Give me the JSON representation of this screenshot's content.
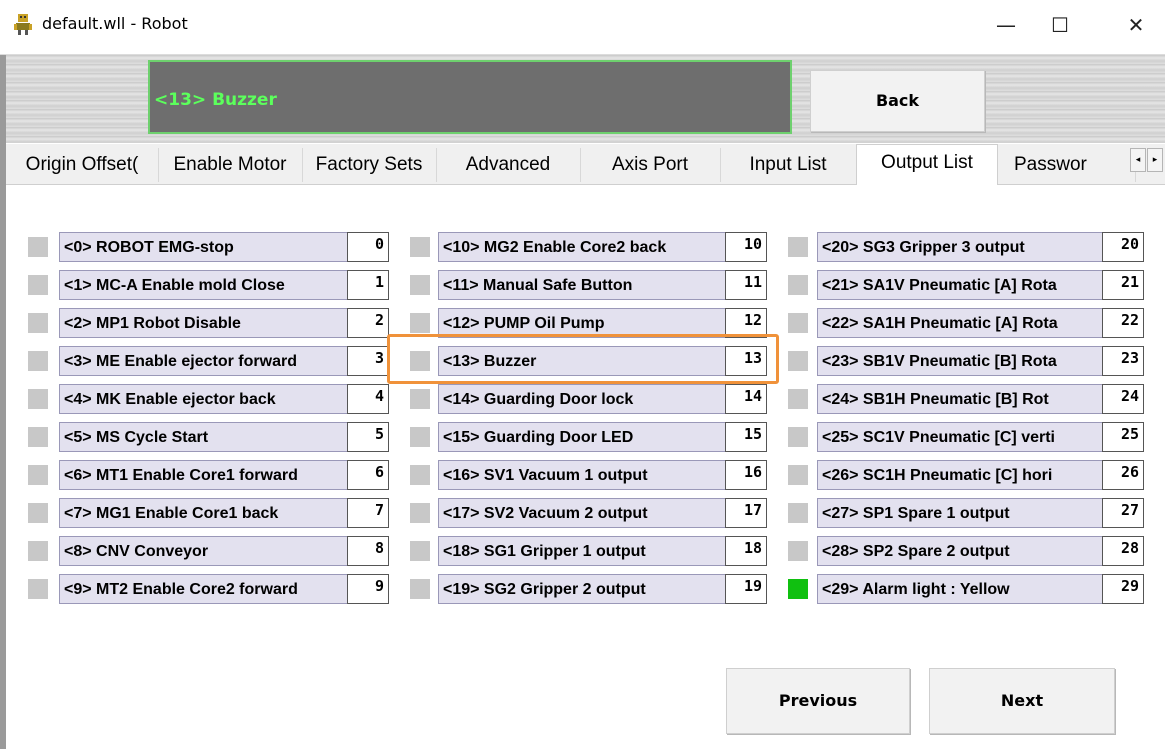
{
  "window": {
    "title": "default.wll - Robot",
    "controls": {
      "minimize": "—",
      "maximize": "☐",
      "close": "✕"
    }
  },
  "display": {
    "text": "<13> Buzzer"
  },
  "buttons": {
    "back": "Back",
    "previous": "Previous",
    "next": "Next"
  },
  "tabs": [
    {
      "label": "Origin Offset(",
      "active": false
    },
    {
      "label": "Enable Motor",
      "active": false
    },
    {
      "label": "Factory Sets",
      "active": false
    },
    {
      "label": "Advanced",
      "active": false
    },
    {
      "label": "Axis Port",
      "active": false
    },
    {
      "label": "Input List",
      "active": false
    },
    {
      "label": "Output List",
      "active": true
    },
    {
      "label": "Passwor",
      "active": false
    }
  ],
  "tab_scroll": {
    "left": "◂",
    "right": "▸"
  },
  "outputs": [
    {
      "label": "<0> ROBOT EMG-stop",
      "number": "0",
      "on": false
    },
    {
      "label": "<1> MC-A Enable mold Close",
      "number": "1",
      "on": false
    },
    {
      "label": "<2> MP1 Robot Disable",
      "number": "2",
      "on": false
    },
    {
      "label": "<3> ME Enable ejector forward",
      "number": "3",
      "on": false
    },
    {
      "label": "<4> MK Enable ejector back",
      "number": "4",
      "on": false
    },
    {
      "label": "<5> MS Cycle Start",
      "number": "5",
      "on": false
    },
    {
      "label": "<6> MT1 Enable Core1 forward",
      "number": "6",
      "on": false
    },
    {
      "label": "<7> MG1 Enable Core1 back",
      "number": "7",
      "on": false
    },
    {
      "label": "<8> CNV Conveyor",
      "number": "8",
      "on": false
    },
    {
      "label": "<9> MT2 Enable Core2 forward",
      "number": "9",
      "on": false
    },
    {
      "label": "<10> MG2 Enable Core2 back",
      "number": "10",
      "on": false
    },
    {
      "label": "<11> Manual Safe Button",
      "number": "11",
      "on": false
    },
    {
      "label": "<12> PUMP Oil Pump",
      "number": "12",
      "on": false
    },
    {
      "label": "<13> Buzzer",
      "number": "13",
      "on": false
    },
    {
      "label": "<14>  Guarding Door lock",
      "number": "14",
      "on": false
    },
    {
      "label": "<15> Guarding Door LED",
      "number": "15",
      "on": false
    },
    {
      "label": "<16> SV1 Vacuum 1 output",
      "number": "16",
      "on": false
    },
    {
      "label": "<17> SV2 Vacuum 2 output",
      "number": "17",
      "on": false
    },
    {
      "label": "<18> SG1 Gripper 1 output",
      "number": "18",
      "on": false
    },
    {
      "label": "<19> SG2 Gripper 2 output",
      "number": "19",
      "on": false
    },
    {
      "label": "<20> SG3 Gripper 3 output",
      "number": "20",
      "on": false
    },
    {
      "label": "<21> SA1V Pneumatic [A] Rota",
      "number": "21",
      "on": false
    },
    {
      "label": "<22> SA1H Pneumatic [A] Rota",
      "number": "22",
      "on": false
    },
    {
      "label": "<23> SB1V Pneumatic [B] Rota",
      "number": "23",
      "on": false
    },
    {
      "label": "<24> SB1H Pneumatic [B] Rot",
      "number": "24",
      "on": false
    },
    {
      "label": "<25> SC1V Pneumatic [C] verti",
      "number": "25",
      "on": false
    },
    {
      "label": "<26> SC1H Pneumatic [C] hori",
      "number": "26",
      "on": false
    },
    {
      "label": "<27> SP1 Spare 1 output",
      "number": "27",
      "on": false
    },
    {
      "label": "<28> SP2 Spare 2 output",
      "number": "28",
      "on": false
    },
    {
      "label": "<29> Alarm light : Yellow",
      "number": "29",
      "on": true
    }
  ],
  "selected_output": "13",
  "colors": {
    "led_off": "#c8c8c8",
    "led_on": "#10c010",
    "display_bg": "#6e6e6e",
    "display_text": "#5cff5c",
    "highlight": "#f0923a"
  }
}
